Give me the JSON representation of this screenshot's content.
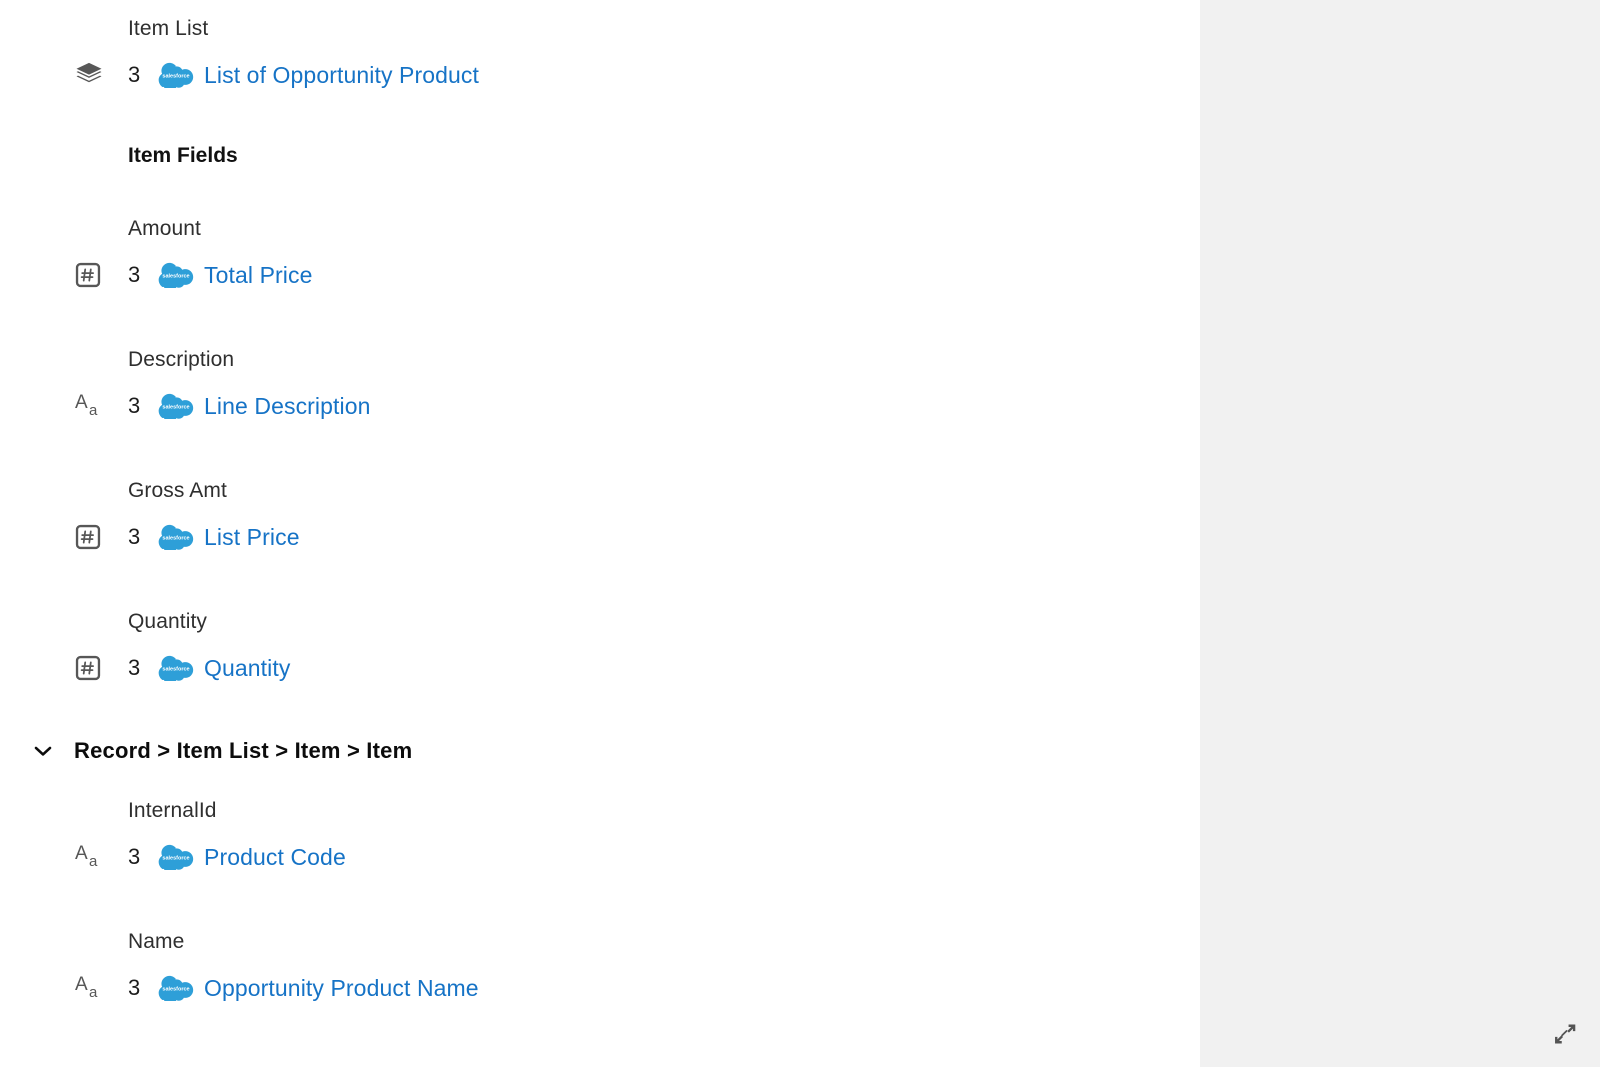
{
  "panel": {
    "background_color": "#ffffff",
    "right_panel_color": "#f1f1f1",
    "link_color": "#1673c6",
    "salesforce_blue": "#2e9fd8"
  },
  "top_mapping": {
    "label": "Item List",
    "icon": "layers-icon",
    "count": "3",
    "source_logo": "salesforce-logo",
    "target": "List of Opportunity Product"
  },
  "item_fields_heading": "Item Fields",
  "item_fields": [
    {
      "label": "Amount",
      "icon": "number-icon",
      "count": "3",
      "source_logo": "salesforce-logo",
      "target": "Total Price"
    },
    {
      "label": "Description",
      "icon": "text-icon",
      "count": "3",
      "source_logo": "salesforce-logo",
      "target": "Line Description"
    },
    {
      "label": "Gross Amt",
      "icon": "number-icon",
      "count": "3",
      "source_logo": "salesforce-logo",
      "target": "List Price"
    },
    {
      "label": "Quantity",
      "icon": "number-icon",
      "count": "3",
      "source_logo": "salesforce-logo",
      "target": "Quantity"
    }
  ],
  "group": {
    "chevron_icon": "chevron-down-icon",
    "breadcrumb": "Record > Item List > Item > Item",
    "expanded": true,
    "fields": [
      {
        "label": "InternalId",
        "icon": "text-icon",
        "count": "3",
        "source_logo": "salesforce-logo",
        "target": "Product Code"
      },
      {
        "label": "Name",
        "icon": "text-icon",
        "count": "3",
        "source_logo": "salesforce-logo",
        "target": "Opportunity Product Name"
      }
    ]
  },
  "resize": {
    "icon": "resize-diagonal-icon"
  },
  "salesforce_logo_text": "salesforce"
}
